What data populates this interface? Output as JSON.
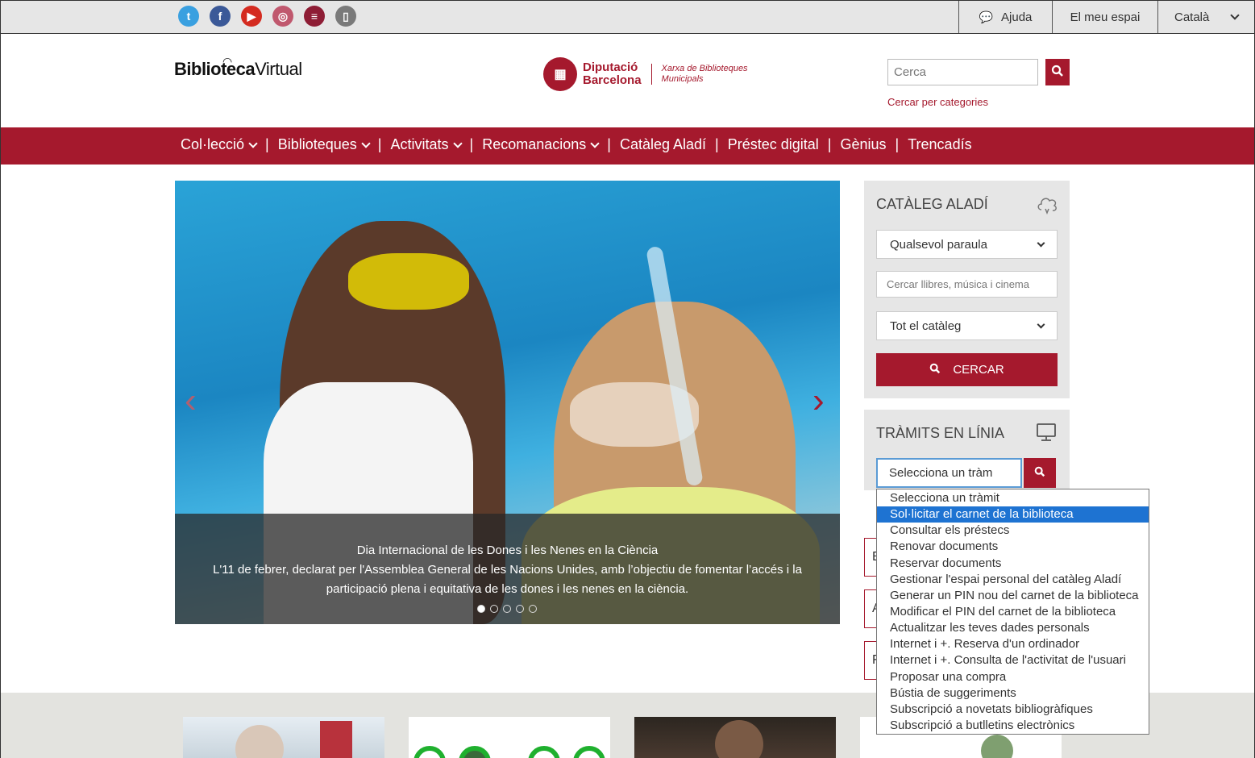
{
  "topbar": {
    "social": [
      {
        "icon": "twitter-icon",
        "glyph": "t",
        "color": "#3aa0e0"
      },
      {
        "icon": "facebook-icon",
        "glyph": "f",
        "color": "#3b5998"
      },
      {
        "icon": "youtube-icon",
        "glyph": "▶",
        "color": "#d42b20"
      },
      {
        "icon": "instagram-icon",
        "glyph": "◎",
        "color": "#c0586e"
      },
      {
        "icon": "blog-icon",
        "glyph": "≡",
        "color": "#8e1d35"
      },
      {
        "icon": "mobile-icon",
        "glyph": "▯",
        "color": "#7a7a7a"
      }
    ],
    "help": "Ajuda",
    "my_space": "El meu espai",
    "language": "Català"
  },
  "header": {
    "logo_bold": "Biblioteca",
    "logo_light": "Virtual",
    "dipu_line1": "Diputació",
    "dipu_line2": "Barcelona",
    "xarxa_line1": "Xarxa de Biblioteques",
    "xarxa_line2": "Municipals",
    "search_placeholder": "Cerca",
    "categories_link": "Cercar per categories"
  },
  "mainnav": [
    {
      "label": "Col·lecció",
      "has_menu": true
    },
    {
      "label": "Biblioteques",
      "has_menu": true
    },
    {
      "label": "Activitats",
      "has_menu": true
    },
    {
      "label": "Recomanacions",
      "has_menu": true
    },
    {
      "label": "Catàleg Aladí",
      "has_menu": false
    },
    {
      "label": "Préstec digital",
      "has_menu": false
    },
    {
      "label": "Gènius",
      "has_menu": false
    },
    {
      "label": "Trencadís",
      "has_menu": false
    }
  ],
  "hero": {
    "caption_title": "Dia Internacional de les Dones i les Nenes en la Ciència",
    "caption_body": "L'11 de febrer, declarat per l'Assemblea General de les Nacions Unides, amb l’objectiu de fomentar l’accés i la participació plena i equitativa de les dones i les nenes en la ciència.",
    "slide_count": 5,
    "active_slide": 1
  },
  "catalog": {
    "title": "CATÀLEG ALADÍ",
    "word_select": "Qualsevol paraula",
    "input_placeholder": "Cercar llibres, música i cinema",
    "scope_select": "Tot el catàleg",
    "search_button": "CERCAR"
  },
  "tramits": {
    "title": "TRÀMITS EN LÍNIA",
    "select_value": "Selecciona un tràm",
    "options": [
      "Selecciona un tràmit",
      "Sol·licitar el carnet de la biblioteca",
      "Consultar els préstecs",
      "Renovar documents",
      "Reservar documents",
      "Gestionar l'espai personal del catàleg Aladí",
      "Generar un PIN nou del carnet de la biblioteca",
      "Modificar el PIN del carnet de la biblioteca",
      "Actualitzar les teves dades personals",
      "Internet i +. Reserva d'un ordinador",
      "Internet i +. Consulta de l'activitat de l'usuari",
      "Proposar una compra",
      "Bústia de suggeriments",
      "Subscripció a novetats bibliogràfiques",
      "Subscripció a butlletins electrònics"
    ],
    "highlighted_index": 1
  },
  "hidden_boxes": [
    "E",
    "A",
    "F"
  ],
  "colors": {
    "brand": "#a5192d",
    "highlight": "#1e73d2"
  }
}
